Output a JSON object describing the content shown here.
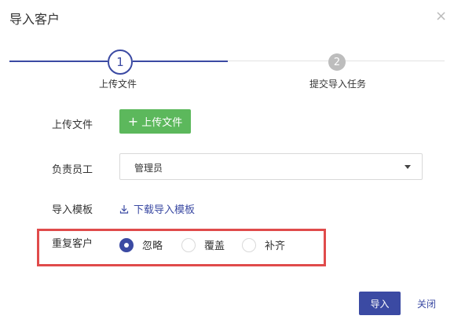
{
  "dialog": {
    "title": "导入客户",
    "close_glyph": "×"
  },
  "steps": [
    {
      "number": "1",
      "label": "上传文件",
      "state": "active"
    },
    {
      "number": "2",
      "label": "提交导入任务",
      "state": "pending"
    }
  ],
  "form": {
    "upload": {
      "label": "上传文件",
      "button_label": "上传文件"
    },
    "owner": {
      "label": "负责员工",
      "selected": "管理员"
    },
    "template": {
      "label": "导入模板",
      "link_label": "下载导入模板"
    },
    "duplicate": {
      "label": "重复客户",
      "options": [
        {
          "label": "忽略",
          "checked": true
        },
        {
          "label": "覆盖",
          "checked": false
        },
        {
          "label": "补齐",
          "checked": false
        }
      ]
    }
  },
  "footer": {
    "import_label": "导入",
    "close_label": "关闭"
  },
  "colors": {
    "primary": "#3b4aa3",
    "upload_green": "#5cb85c",
    "highlight_red": "#e04b4b"
  }
}
